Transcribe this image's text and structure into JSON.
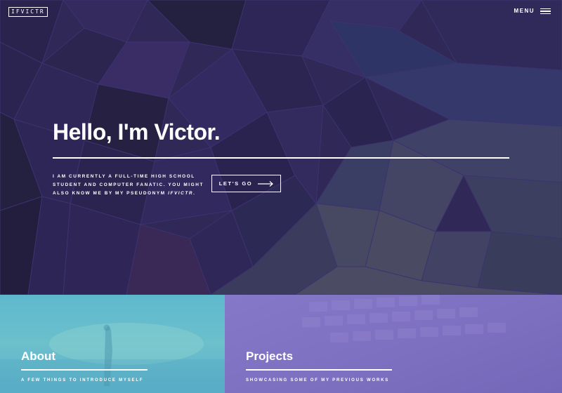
{
  "header": {
    "logo_text": "IFVICTR",
    "menu_label": "MENU"
  },
  "hero": {
    "title": "Hello, I'm Victor.",
    "intro_text": "I am currently a full-time high school student and computer fanatic. You might also know me by my pseudonym",
    "intro_pseudonym": "ifvictr",
    "intro_end": ".",
    "cta_label": "LET'S GO"
  },
  "sections": [
    {
      "title": "About",
      "subtitle": "A few things to introduce myself",
      "color": "#5fb8cb"
    },
    {
      "title": "Projects",
      "subtitle": "Showcasing some of my previous works",
      "color": "#8274c5"
    }
  ],
  "colors": {
    "hero_bg": "#302857",
    "text": "#ffffff"
  }
}
